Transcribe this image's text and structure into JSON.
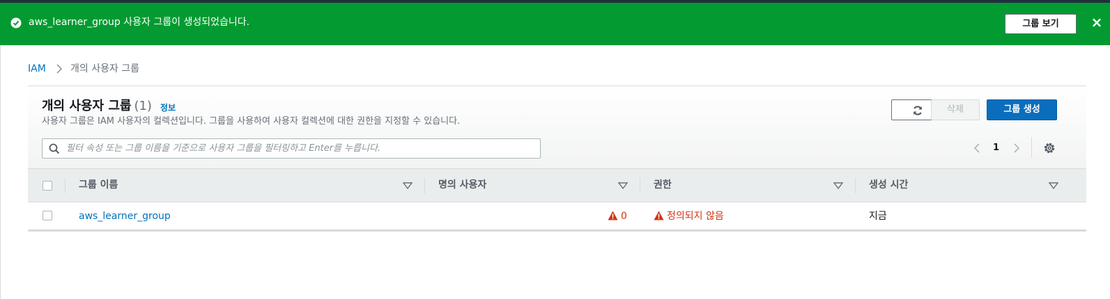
{
  "flash": {
    "message": "aws_learner_group 사용자 그룹이 생성되었습니다.",
    "view_button": "그룹 보기",
    "close_glyph": "×",
    "color": "#039b31"
  },
  "breadcrumb": {
    "root": "IAM",
    "current": "개의 사용자 그룹"
  },
  "panel": {
    "title": "개의 사용자 그룹",
    "count": "(1)",
    "info_link": "정보",
    "description": "사용자 그룹은 IAM 사용자의 컬렉션입니다. 그룹을 사용하여 사용자 컬렉션에 대한 권한을 지정할 수 있습니다.",
    "delete_label": "삭제",
    "create_label": "그룹 생성",
    "search_placeholder": "필터 속성 또는 그룹 이름을 기준으로 사용자 그룹을 필터링하고 Enter를 누릅니다.",
    "page_number": "1"
  },
  "table": {
    "columns": [
      "그룹 이름",
      "명의 사용자",
      "권한",
      "생성 시간"
    ],
    "rows": [
      {
        "name": "aws_learner_group",
        "users": "0",
        "permissions": "정의되지 않음",
        "created": "지금"
      }
    ]
  },
  "icons": [
    "check-circle-icon",
    "close-icon",
    "chevron-right-icon",
    "refresh-icon",
    "search-icon",
    "chevron-left-icon",
    "gear-icon",
    "sort-caret-icon",
    "warning-icon"
  ],
  "colors": {
    "link": "#0073bb",
    "primary": "#0a6ebd",
    "warning": "#d13212"
  }
}
